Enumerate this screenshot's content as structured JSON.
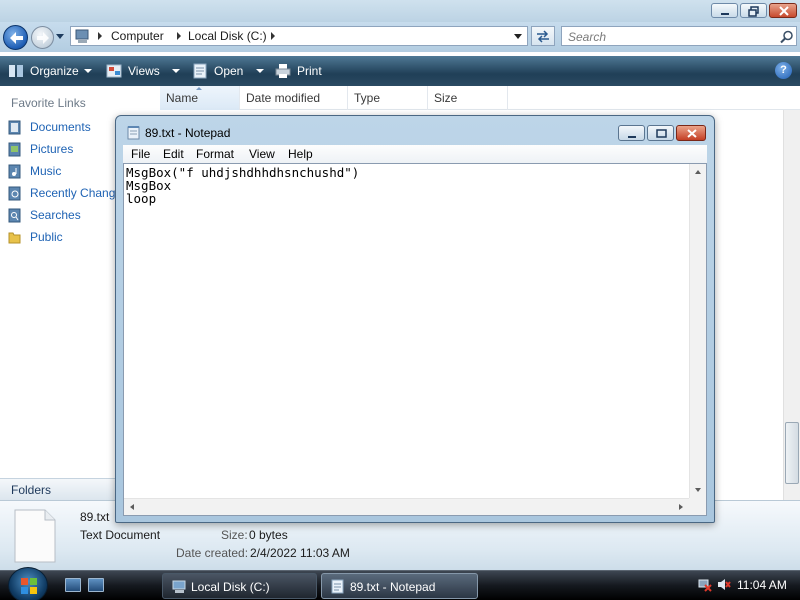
{
  "explorer": {
    "breadcrumb": [
      "Computer",
      "Local Disk (C:)"
    ],
    "search_placeholder": "Search",
    "commands": [
      {
        "label": "Organize"
      },
      {
        "label": "Views"
      },
      {
        "label": "Open"
      },
      {
        "label": "Print"
      }
    ],
    "help_label": "?",
    "favorite_links_header": "Favorite Links",
    "favorite_links": [
      {
        "label": "Documents"
      },
      {
        "label": "Pictures"
      },
      {
        "label": "Music"
      },
      {
        "label": "Recently Changed"
      },
      {
        "label": "Searches"
      },
      {
        "label": "Public"
      }
    ],
    "folders_label": "Folders",
    "columns": [
      "Name",
      "Date modified",
      "Type",
      "Size"
    ],
    "details": {
      "filename": "89.txt",
      "filetype": "Text Document",
      "size_label": "Size:",
      "size_value": "0 bytes",
      "date_label": "Date created:",
      "date_value": "2/4/2022 11:03 AM"
    }
  },
  "notepad": {
    "title": "89.txt - Notepad",
    "menu": [
      "File",
      "Edit",
      "Format",
      "View",
      "Help"
    ],
    "content": "MsgBox(\"f uhdjshdhhdhsnchushd\")\nMsgBox\nloop"
  },
  "taskbar": {
    "buttons": [
      {
        "label": "Local Disk (C:)"
      },
      {
        "label": "89.txt - Notepad"
      }
    ],
    "clock": "11:04 AM"
  },
  "colors": {
    "link_blue": "#1f63b4",
    "cmdbar": "#203f57",
    "taskbar": "#15191f"
  }
}
